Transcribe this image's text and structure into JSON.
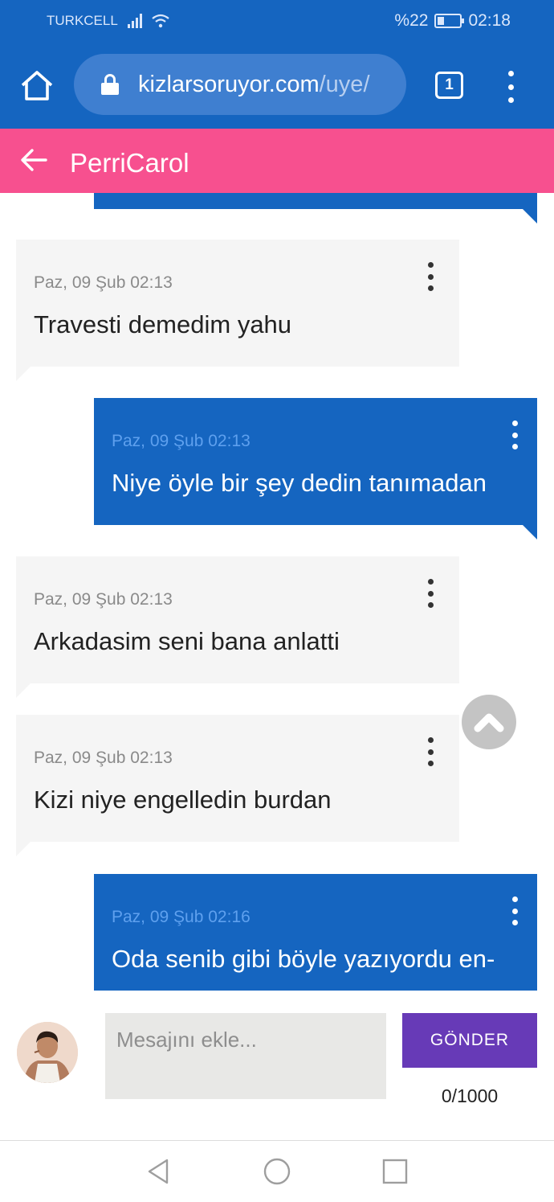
{
  "status_bar": {
    "carrier": "TURKCELL",
    "battery": "%22",
    "time": "02:18"
  },
  "browser": {
    "url_domain": "kizlarsoruyor.com",
    "url_path": "/uye/",
    "tab_count": "1"
  },
  "header": {
    "title": "PerriCarol"
  },
  "messages": [
    {
      "direction": "in",
      "time": "Paz, 09 Şub 02:13",
      "text": "Travesti demedim yahu"
    },
    {
      "direction": "out",
      "time": "Paz, 09 Şub 02:13",
      "text": "Niye öyle bir şey dedin tanımadan"
    },
    {
      "direction": "in",
      "time": "Paz, 09 Şub 02:13",
      "text": "Arkadasim seni bana anlatti"
    },
    {
      "direction": "in",
      "time": "Paz, 09 Şub 02:13",
      "text": "Kizi niye engelledin burdan"
    },
    {
      "direction": "out",
      "time": "Paz, 09 Şub 02:16",
      "text": "Oda senib gibi böyle yazıyordu en-"
    }
  ],
  "composer": {
    "placeholder": "Mesajını ekle...",
    "value": "",
    "send_label": "GÖNDER",
    "char_count": "0/1000"
  },
  "colors": {
    "browser_blue": "#1565c0",
    "header_pink": "#f7508f",
    "outgoing_bubble": "#1565c0",
    "incoming_bubble": "#f5f5f5",
    "send_button": "#673ab7"
  },
  "icons": {
    "home": "home-icon",
    "lock": "lock-icon",
    "tabs": "tab-switcher-icon",
    "menu": "kebab-menu-icon",
    "back": "arrow-left-icon",
    "scroll_top": "chevron-up-icon",
    "message_menu": "vertical-dots-icon"
  }
}
